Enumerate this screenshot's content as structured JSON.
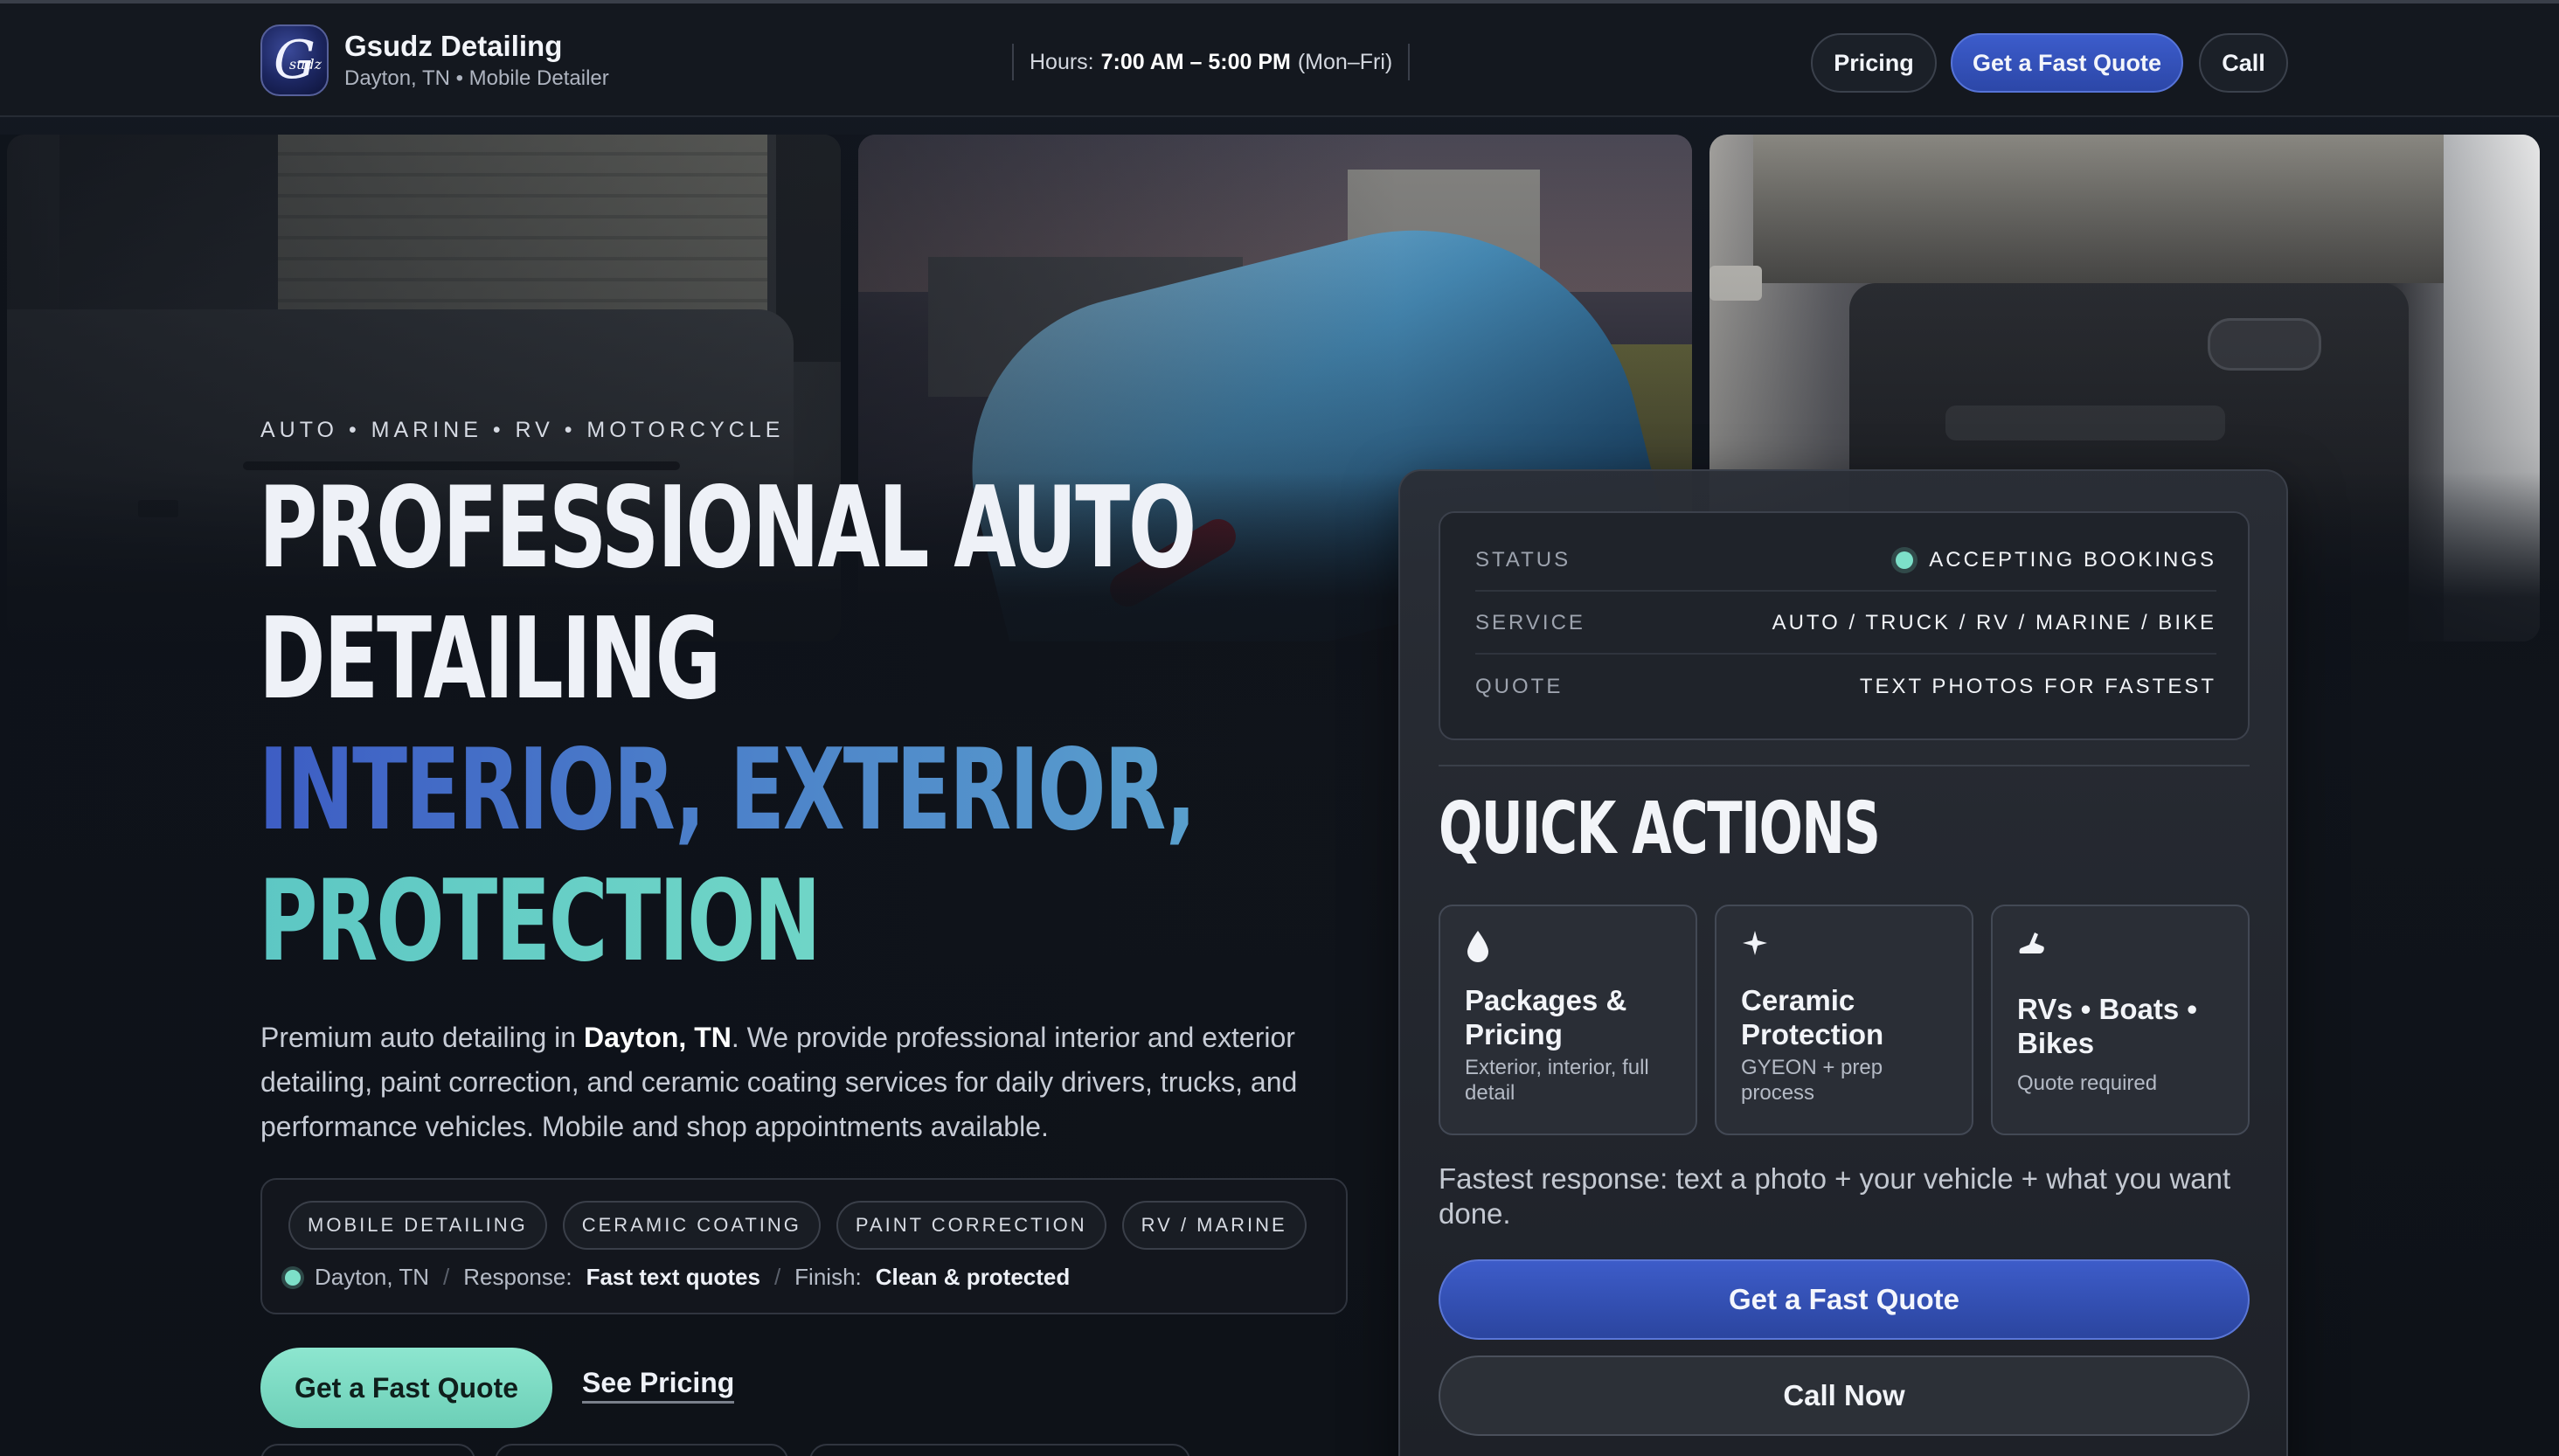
{
  "header": {
    "brand_name": "Gsudz Detailing",
    "brand_sub": "Dayton, TN • Mobile Detailer",
    "logo_letter": "G",
    "logo_script": "sudz",
    "hours_label": "Hours:",
    "hours_value": "7:00 AM – 5:00 PM",
    "hours_days": "(Mon–Fri)",
    "nav": {
      "pricing": "Pricing",
      "quote": "Get a Fast Quote",
      "call": "Call"
    }
  },
  "hero": {
    "kicker": "AUTO • MARINE • RV • MOTORCYCLE",
    "title_line1": "PROFESSIONAL AUTO",
    "title_line2": "DETAILING",
    "title_line3": "INTERIOR, EXTERIOR,",
    "title_line4": "PROTECTION",
    "lead_part1": "Premium auto detailing in ",
    "lead_bold": "Dayton, TN",
    "lead_part2": ". We provide professional interior and exterior detailing, paint correction, and ceramic coating services for daily drivers, trucks, and performance vehicles. Mobile and shop appointments available.",
    "tags": [
      "MOBILE DETAILING",
      "CERAMIC COATING",
      "PAINT CORRECTION",
      "RV / MARINE"
    ],
    "meta": {
      "location": "Dayton, TN",
      "sep": "/",
      "response_label": "Response:",
      "response_value": "Fast text quotes",
      "finish_label": "Finish:",
      "finish_value": "Clean & protected"
    },
    "cta_primary": "Get a Fast Quote",
    "cta_link": "See Pricing"
  },
  "panel": {
    "status_rows": [
      {
        "key": "STATUS",
        "value": "ACCEPTING BOOKINGS"
      },
      {
        "key": "SERVICE",
        "value": "AUTO / TRUCK / RV / MARINE / BIKE"
      },
      {
        "key": "QUOTE",
        "value": "TEXT PHOTOS FOR FASTEST"
      }
    ],
    "quick_title": "QUICK ACTIONS",
    "cards": [
      {
        "icon": "droplet-icon",
        "glyph": "💧",
        "title": "Packages & Pricing",
        "desc": "Exterior, interior, full detail"
      },
      {
        "icon": "sparkle-icon",
        "glyph": "✦",
        "title": "Ceramic Protection",
        "desc": "GYEON + prep process"
      },
      {
        "icon": "boot-icon",
        "glyph": "◢",
        "title": "RVs • Boats • Bikes",
        "desc": "Quote required"
      }
    ],
    "fast_text": "Fastest response: text a photo + your vehicle + what you want done.",
    "primary_button": "Get a Fast Quote",
    "secondary_button": "Call Now"
  },
  "colors": {
    "accent_blue": "#3c5ccb",
    "accent_teal": "#7de0c9",
    "background": "#0f131a"
  }
}
